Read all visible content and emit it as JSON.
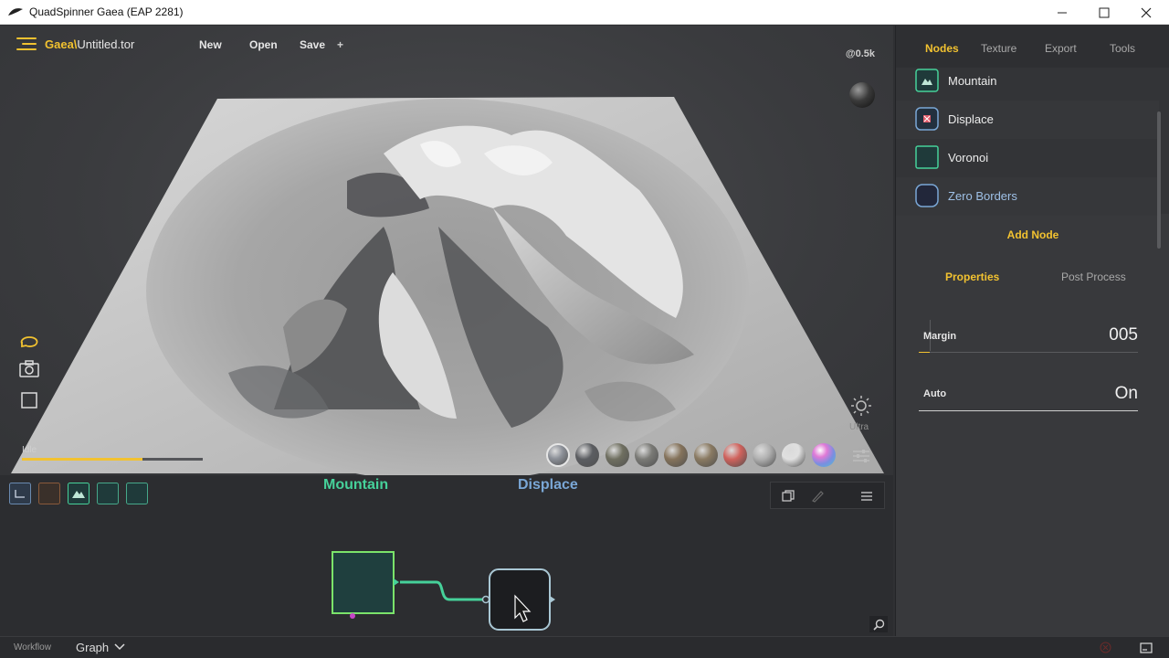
{
  "window": {
    "title": "QuadSpinner Gaea (EAP 2281)",
    "minimize": "—",
    "maximize": "☐",
    "close": "✕"
  },
  "toolbar": {
    "brand": "Gaea\\",
    "file_name": "Untitled.tor",
    "new_label": "New",
    "open_label": "Open",
    "save_label": "Save",
    "plus_label": "+"
  },
  "viewport": {
    "resolution_label": "@0.5k",
    "status": "Idle",
    "progress": 0.67,
    "quality_label": "Ultra",
    "material_swatches": [
      {
        "name": "slate",
        "color": "#8d9199"
      },
      {
        "name": "dark-grey",
        "color": "#5b5d61"
      },
      {
        "name": "mossy",
        "color": "#6f6f60"
      },
      {
        "name": "grey-rock",
        "color": "#7a7a76"
      },
      {
        "name": "sandstone",
        "color": "#85735b"
      },
      {
        "name": "desert",
        "color": "#8a7a62"
      },
      {
        "name": "red-clay",
        "color": "#d0625c"
      },
      {
        "name": "chrome",
        "color": "#b0b0b0"
      },
      {
        "name": "white",
        "color": "#e0e0e0"
      },
      {
        "name": "iridescent",
        "color": "#a07ee0"
      }
    ]
  },
  "graph": {
    "node_title_left": "Mountain",
    "node_title_right": "Displace",
    "mountain_color": "#46d19a",
    "displace_color": "#7aa7d6"
  },
  "bottombar": {
    "workflow_label": "Workflow",
    "mode_label": "Graph"
  },
  "panel": {
    "tabs": [
      "Nodes",
      "Texture",
      "Export",
      "Tools"
    ],
    "nodes": [
      {
        "label": "Mountain",
        "icon": "mountain-icon"
      },
      {
        "label": "Displace",
        "icon": "displace-icon"
      },
      {
        "label": "Voronoi",
        "icon": "voronoi-icon"
      },
      {
        "label": "Zero Borders",
        "icon": "zero-borders-icon"
      }
    ],
    "add_node_label": "Add Node",
    "properties_tab": "Properties",
    "post_process_tab": "Post Process",
    "margin_label": "Margin",
    "margin_value": "005",
    "auto_label": "Auto",
    "auto_value": "On"
  },
  "colors": {
    "accent": "#f2c230",
    "panel_bg": "#38393c"
  }
}
